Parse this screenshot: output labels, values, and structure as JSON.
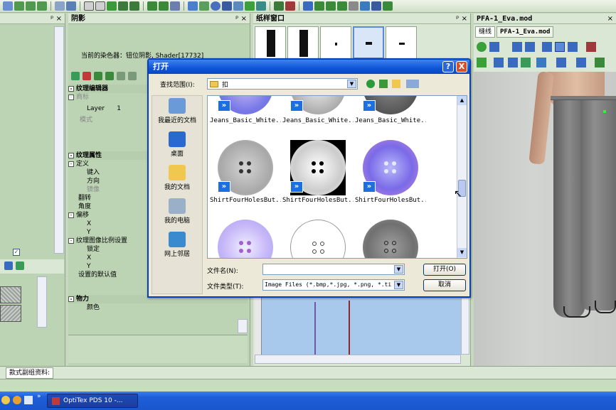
{
  "panels": {
    "shadow": {
      "title": "阴影",
      "pin": "ᵖ ×",
      "shader_info": "当前的染色器：钮位阴影, Shader[17732]"
    },
    "paper": {
      "title": "纸样窗口",
      "pin": "ᵖ ×"
    },
    "model": {
      "title": "PFA-1_Eva.mod",
      "pin": "×",
      "tabs": [
        "缝线",
        "PFA-1_Eva.mod"
      ]
    },
    "left": {
      "pin": "ᵖ ×"
    }
  },
  "props": {
    "texture_editor": "纹理编辑器",
    "item_mark": "商标",
    "layer_label": "Layer",
    "layer_value": "1",
    "mode": "模式",
    "texture_props": "纹理属性",
    "define": "定义",
    "key_in": "键入",
    "direction": "方向",
    "mirror": "镜像",
    "flip": "翻转",
    "angle": "角度",
    "offset": "偏移",
    "x1": "X",
    "y1": "Y",
    "ratio": "纹理图像比例设置",
    "lock": "锁定",
    "x2": "X",
    "y2": "Y",
    "default": "设置的默认值",
    "physics": "物力",
    "physics_sub": "颜色"
  },
  "bottom_tab": "款式副组资料:",
  "dialog": {
    "title": "打开",
    "help_btn": "?",
    "close_btn": "X",
    "look_in_label": "查找范围(I):",
    "look_in_value": "扣",
    "places": [
      "我最近的文档",
      "桌面",
      "我的文档",
      "我的电脑",
      "网上邻居"
    ],
    "files": [
      "Jeans_Basic_White...",
      "Jeans_Basic_White...",
      "Jeans_Basic_White...",
      "ShirtFourHolesBut...",
      "ShirtFourHolesBut...",
      "ShirtFourHolesBut..."
    ],
    "filename_label": "文件名(N):",
    "filename_value": "",
    "filetype_label": "文件类型(T):",
    "filetype_value": "Image Files (*.bmp,*.jpg, *.png, *.ti",
    "open_btn": "打开(O)",
    "cancel_btn": "取消"
  },
  "taskbar": {
    "app": "OptiTex PDS 10 -..."
  },
  "colors": {
    "xp_blue": "#0a47c0",
    "panel_green": "#bcd4b4",
    "pants_gray": "#707070"
  }
}
